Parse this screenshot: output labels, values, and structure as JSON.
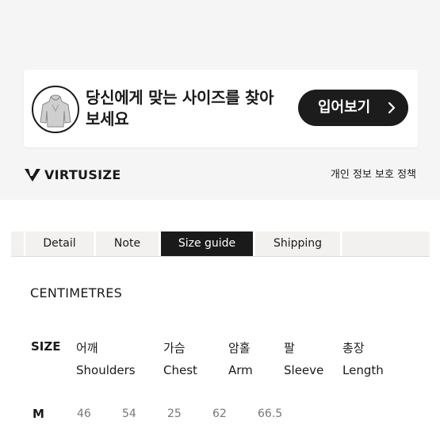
{
  "banner": {
    "avatar_icon": "hoodie-icon",
    "headline_line1": "당신에게 맞는 사이즈를 찾아",
    "headline_line2": "보세요",
    "try_button_label": "입어보기",
    "try_button_icon": "chevron-right-icon"
  },
  "footer_bar": {
    "logo_icon": "virtusize-v-icon",
    "brand": "VIRTUSIZE",
    "privacy_link": "개인 정보 보호 정책"
  },
  "tabs": {
    "items": [
      {
        "label": "Detail"
      },
      {
        "label": "Note"
      },
      {
        "label": "Size guide"
      },
      {
        "label": "Shipping"
      }
    ],
    "active": "Size guide"
  },
  "size_guide": {
    "unit": "CENTIMETRES",
    "size_header": "SIZE",
    "columns": [
      {
        "kr": "어깨",
        "en": "Shoulders"
      },
      {
        "kr": "가슴",
        "en": "Chest"
      },
      {
        "kr": "암홀",
        "en": "Arm"
      },
      {
        "kr": "팔",
        "en": "Sleeve"
      },
      {
        "kr": "총장",
        "en": "Length"
      }
    ],
    "rows": [
      {
        "size": "M",
        "values": [
          "46",
          "54",
          "25",
          "62",
          "66.5"
        ]
      }
    ]
  },
  "colors": {
    "dark": "#1a1a1a",
    "tab_bg": "#f3f1ef",
    "panel_bg": "#f5f5f5",
    "muted_value": "#777777"
  }
}
